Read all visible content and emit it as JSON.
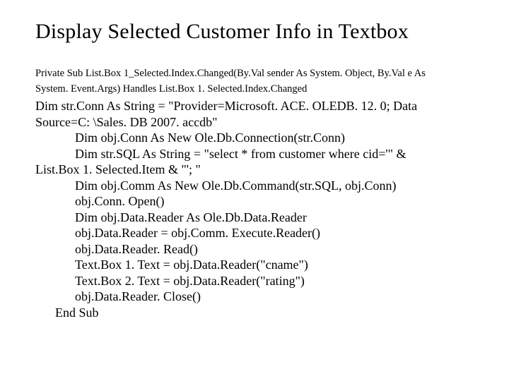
{
  "title": "Display Selected Customer Info in Textbox",
  "sig1": "Private Sub List.Box 1_Selected.Index.Changed(By.Val sender As System. Object, By.Val e As",
  "sig2": "System. Event.Args) Handles List.Box 1. Selected.Index.Changed",
  "l1a": " Dim str.Conn As String = \"Provider=Microsoft. ACE. OLEDB. 12. 0; Data",
  "l1b": "Source=C: \\Sales. DB 2007. accdb\"",
  "l2": "Dim obj.Conn As New Ole.Db.Connection(str.Conn)",
  "l3a": "Dim str.SQL As String = \"select * from customer where cid='\" &",
  "l3b": "List.Box 1. Selected.Item & \"'; \"",
  "l4": "Dim obj.Comm As New Ole.Db.Command(str.SQL, obj.Conn)",
  "l5": "obj.Conn. Open()",
  "l6": "Dim obj.Data.Reader As Ole.Db.Data.Reader",
  "l7": "obj.Data.Reader = obj.Comm. Execute.Reader()",
  "l8": "obj.Data.Reader. Read()",
  "l9": "Text.Box 1. Text = obj.Data.Reader(\"cname\")",
  "l10": "Text.Box 2. Text = obj.Data.Reader(\"rating\")",
  "l11": "obj.Data.Reader. Close()",
  "l12": "End Sub"
}
